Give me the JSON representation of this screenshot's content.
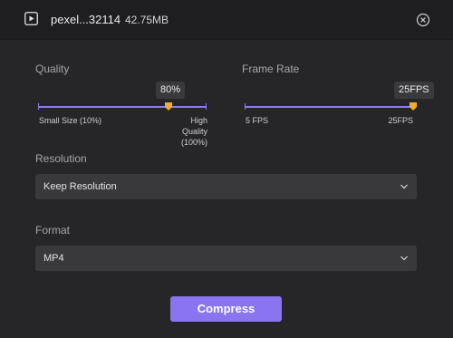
{
  "header": {
    "file_name": "pexel...32114",
    "file_size": "42.75MB",
    "play_icon": "play-icon",
    "close_icon": "close-icon"
  },
  "quality": {
    "label": "Quality",
    "value_text": "80%",
    "value": 80,
    "min_label": "Small Size (10%)",
    "max_label_line1": "High",
    "max_label_line2": "Quality",
    "max_label_line3": "(100%)"
  },
  "frame_rate": {
    "label": "Frame Rate",
    "value_text": "25FPS",
    "value": 25,
    "min_label": "5 FPS",
    "max_label": "25FPS"
  },
  "resolution": {
    "label": "Resolution",
    "selected": "Keep Resolution",
    "chevron_icon": "chevron-down-icon"
  },
  "format": {
    "label": "Format",
    "selected": "MP4",
    "chevron_icon": "chevron-down-icon"
  },
  "actions": {
    "compress_label": "Compress"
  },
  "colors": {
    "accent": "#8a74ef",
    "thumb": "#f2b01e",
    "background": "#262628",
    "header": "#1e1e20"
  }
}
